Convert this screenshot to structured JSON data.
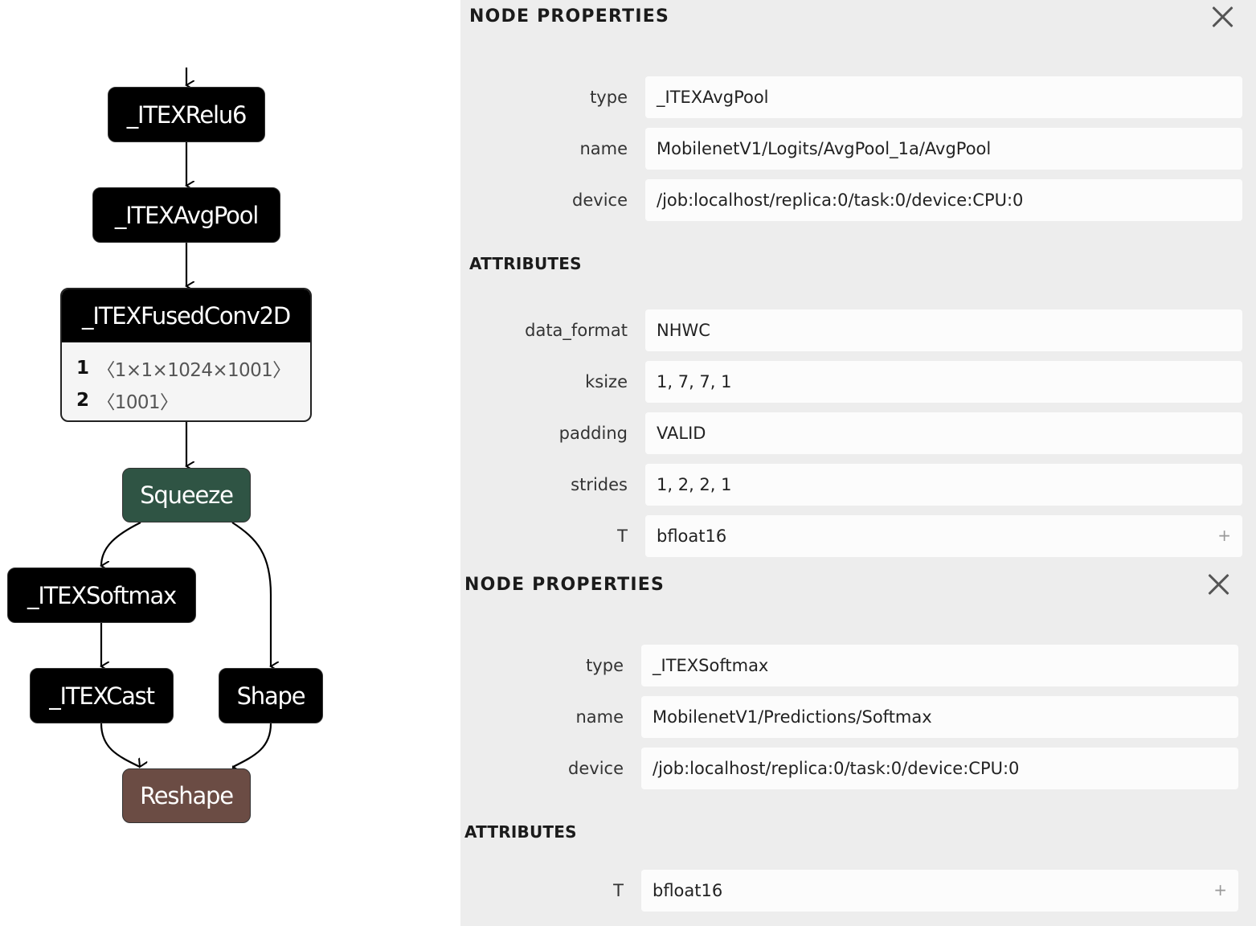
{
  "graph": {
    "nodes": {
      "relu6": {
        "label": "_ITEXRelu6",
        "color": "#000000"
      },
      "avgpool": {
        "label": "_ITEXAvgPool",
        "color": "#000000"
      },
      "fusedconv": {
        "label": "_ITEXFusedConv2D",
        "color": "#000000",
        "inputs": [
          {
            "index": "1",
            "shape": "〈1×1×1024×1001〉"
          },
          {
            "index": "2",
            "shape": "〈1001〉"
          }
        ]
      },
      "squeeze": {
        "label": "Squeeze",
        "color": "#2f5444"
      },
      "softmax": {
        "label": "_ITEXSoftmax",
        "color": "#000000"
      },
      "cast": {
        "label": "_ITEXCast",
        "color": "#000000"
      },
      "shape": {
        "label": "Shape",
        "color": "#000000"
      },
      "reshape": {
        "label": "Reshape",
        "color": "#6b4c44"
      }
    },
    "edges": [
      [
        "input",
        "relu6"
      ],
      [
        "relu6",
        "avgpool"
      ],
      [
        "avgpool",
        "fusedconv"
      ],
      [
        "fusedconv",
        "squeeze"
      ],
      [
        "squeeze",
        "softmax"
      ],
      [
        "squeeze",
        "shape"
      ],
      [
        "softmax",
        "cast"
      ],
      [
        "cast",
        "reshape"
      ],
      [
        "shape",
        "reshape"
      ]
    ]
  },
  "panels": [
    {
      "title": "NODE PROPERTIES",
      "close_icon": "close-icon",
      "properties": [
        {
          "label": "type",
          "value": "_ITEXAvgPool"
        },
        {
          "label": "name",
          "value": "MobilenetV1/Logits/AvgPool_1a/AvgPool"
        },
        {
          "label": "device",
          "value": "/job:localhost/replica:0/task:0/device:CPU:0"
        }
      ],
      "attributes_title": "ATTRIBUTES",
      "attributes": [
        {
          "label": "data_format",
          "value": "NHWC"
        },
        {
          "label": "ksize",
          "value": "1, 7, 7, 1"
        },
        {
          "label": "padding",
          "value": "VALID"
        },
        {
          "label": "strides",
          "value": "1, 2, 2, 1"
        },
        {
          "label": "T",
          "value": "bfloat16",
          "expand": "+"
        }
      ]
    },
    {
      "title": "NODE PROPERTIES",
      "close_icon": "close-icon",
      "properties": [
        {
          "label": "type",
          "value": "_ITEXSoftmax"
        },
        {
          "label": "name",
          "value": "MobilenetV1/Predictions/Softmax"
        },
        {
          "label": "device",
          "value": "/job:localhost/replica:0/task:0/device:CPU:0"
        }
      ],
      "attributes_title": "ATTRIBUTES",
      "attributes": [
        {
          "label": "T",
          "value": "bfloat16",
          "expand": "+"
        }
      ]
    }
  ]
}
